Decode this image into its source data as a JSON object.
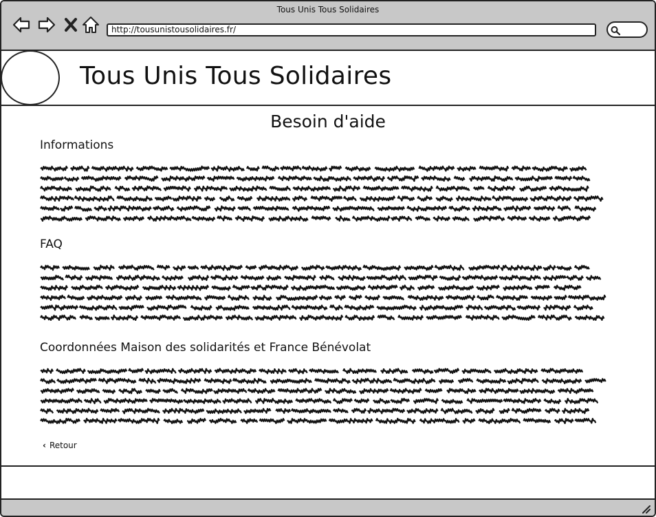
{
  "window": {
    "title": "Tous Unis Tous Solidaires"
  },
  "browser": {
    "url": "http://tousunistousolidaires.fr/",
    "icons": [
      "back-arrow-icon",
      "forward-arrow-icon",
      "close-x-icon",
      "home-icon",
      "search-icon",
      "resize-grip-icon"
    ]
  },
  "header": {
    "site_title": "Tous Unis Tous Solidaires",
    "logo": "logo-placeholder-circle"
  },
  "main": {
    "page_title": "Besoin d'aide",
    "sections": [
      {
        "heading": "Informations",
        "body": "placeholder-lorem-scribble"
      },
      {
        "heading": "FAQ",
        "body": "placeholder-lorem-scribble"
      },
      {
        "heading": "Coordonnées Maison des solidarités et France Bénévolat",
        "body": "placeholder-lorem-scribble"
      }
    ],
    "back_link": {
      "label": "Retour",
      "icon": "chevron-left-icon"
    }
  },
  "colors": {
    "chrome": "#c8c8c8",
    "border": "#222222",
    "text": "#111111"
  }
}
